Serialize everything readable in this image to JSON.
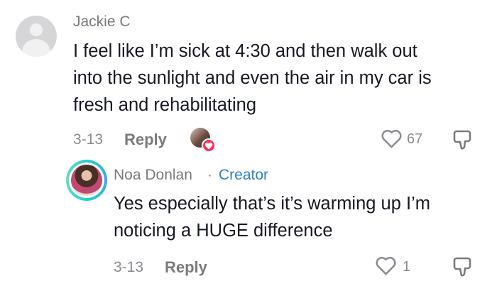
{
  "comment1": {
    "username": "Jackie C",
    "text_lines": [
      "I feel like I’m sick at 4:30 and then walk out",
      "into the sunlight and even the air in my car is",
      "fresh and rehabilitating"
    ],
    "date": "3-13",
    "reply_label": "Reply",
    "like_count": "67"
  },
  "comment2": {
    "username": "Noa Donlan",
    "separator": "·",
    "creator_label": "Creator",
    "text_lines": [
      "Yes especially that’s it’s warming up I’m",
      "noticing a HUGE difference"
    ],
    "date": "3-13",
    "reply_label": "Reply",
    "like_count": "1"
  },
  "colors": {
    "text": "#161823",
    "secondary": "#8a8b91",
    "creator": "#2f7fc1",
    "heart": "#fe2c55"
  },
  "icons": [
    "default-avatar-icon",
    "heart-outline-icon",
    "dislike-icon",
    "liked-heart-badge-icon"
  ]
}
